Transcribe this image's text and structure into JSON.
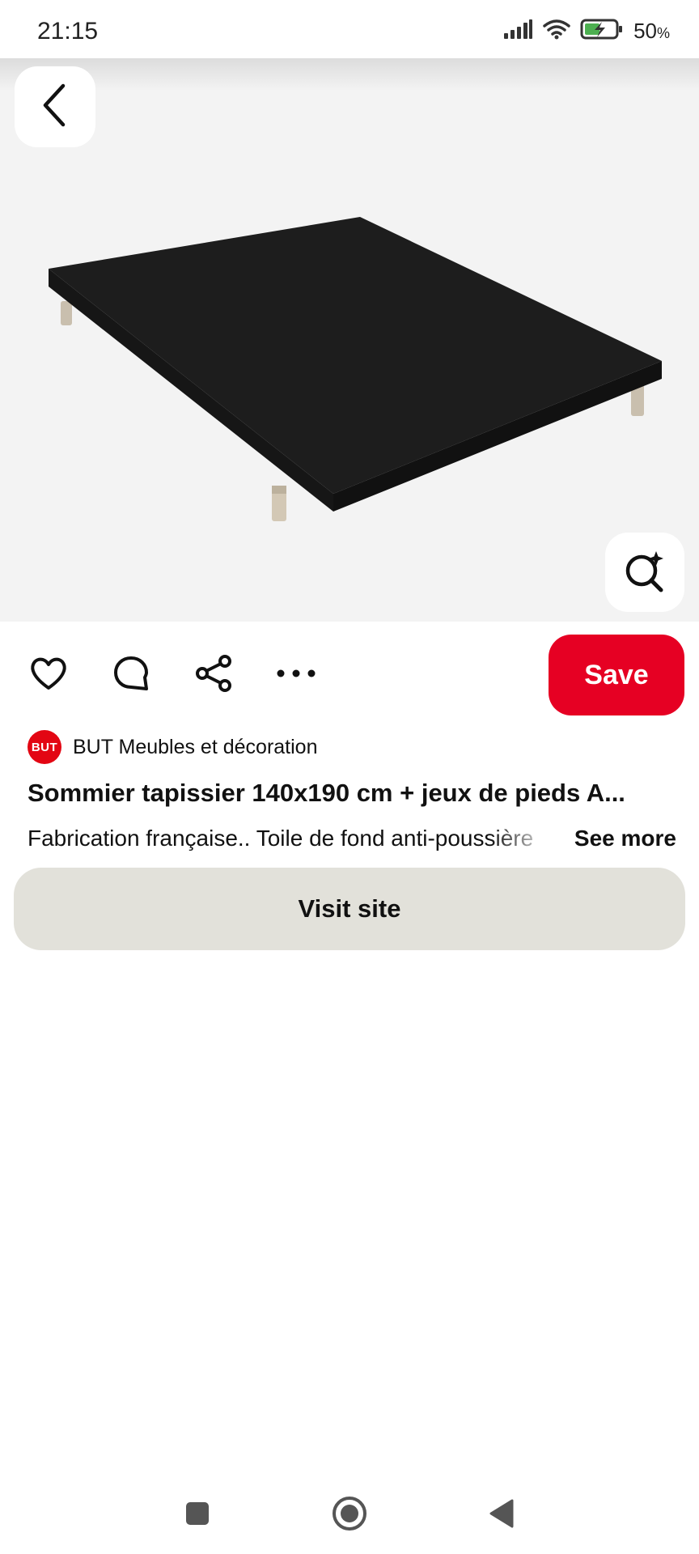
{
  "status_bar": {
    "time": "21:15",
    "battery_percent": "50",
    "battery_unit": "%",
    "icons": [
      "signal-icon",
      "wifi-icon",
      "battery-charging-icon"
    ]
  },
  "image": {
    "subject": "black upholstered bed base with wooden legs",
    "back_icon": "chevron-left-icon",
    "lens_icon": "visual-search-icon"
  },
  "actions": {
    "icons": [
      "heart-icon",
      "comment-icon",
      "share-icon",
      "more-icon"
    ],
    "save_label": "Save",
    "save_color": "#e60023"
  },
  "creator": {
    "avatar_text": "BUT",
    "name": "BUT Meubles et décoration",
    "brand_color": "#e30613"
  },
  "pin": {
    "title": "Sommier tapissier 140x190 cm + jeux de pieds A...",
    "description": "Fabrication française.. Toile de fond anti-poussière",
    "see_more_label": "See more",
    "visit_label": "Visit site"
  },
  "nav_bar": {
    "icons": [
      "recents-icon",
      "home-icon",
      "back-triangle-icon"
    ]
  }
}
